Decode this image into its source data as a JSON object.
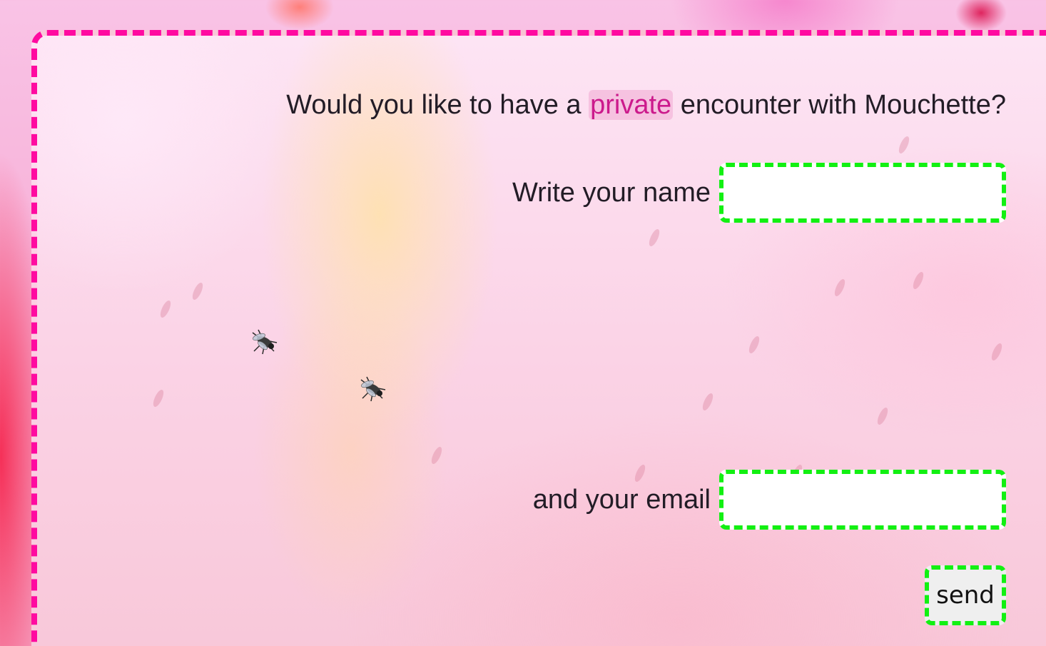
{
  "question": {
    "before": "Would you like to have a ",
    "highlight": "private",
    "after": " encounter with Mouchette?"
  },
  "name_field": {
    "label": "Write your name",
    "value": "",
    "placeholder": ""
  },
  "email_field": {
    "label": "and your email",
    "value": "",
    "placeholder": ""
  },
  "send_button": {
    "label": "send"
  },
  "decorations": {
    "fly_icon": "fly-icon",
    "flower_background": "pink-flower-background"
  },
  "colors": {
    "panel_border": "#ff0aa0",
    "field_border": "#12f012",
    "highlight_text": "#cc1a8c",
    "text": "#221c26"
  }
}
